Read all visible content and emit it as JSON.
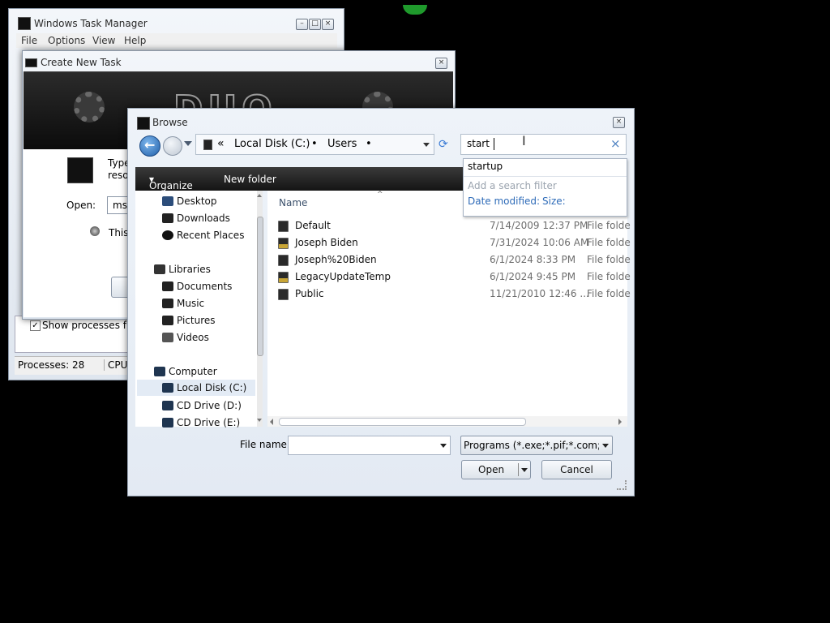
{
  "taskmgr": {
    "title": "Windows Task Manager",
    "menu": [
      "File",
      "Options",
      "View",
      "Help"
    ],
    "show_processes_label": "Show processes from",
    "status_processes": "Processes: 28",
    "status_cpu": "CPU U"
  },
  "create_task": {
    "title": "Create New Task",
    "type_text_1": "Type",
    "type_text_2": "reso",
    "open_label": "Open:",
    "open_value": "msc",
    "this_text": "This",
    "banner_text": "DUO"
  },
  "browse": {
    "title": "Browse",
    "breadcrumb": [
      "«",
      "Local Disk (C:)",
      "•",
      "Users",
      "•"
    ],
    "search_value": "start",
    "search_clear": "×",
    "toolbar": {
      "organize": "Organize",
      "new_folder": "New folder"
    },
    "suggestion": "startup",
    "add_filter": "Add a search filter",
    "filters": [
      "Date modified:",
      "Size:"
    ],
    "column_name": "Name",
    "nav": {
      "favorites": [
        "Desktop",
        "Downloads",
        "Recent Places"
      ],
      "libraries_header": "Libraries",
      "libraries": [
        "Documents",
        "Music",
        "Pictures",
        "Videos"
      ],
      "computer_header": "Computer",
      "drives": [
        "Local Disk (C:)",
        "CD Drive (D:)",
        "CD Drive (E:)"
      ]
    },
    "files": [
      {
        "name": "Default",
        "date": "7/14/2009 12:37 PM",
        "type": "File folde"
      },
      {
        "name": "Joseph Biden",
        "date": "7/31/2024 10:06 AM",
        "type": "File folde"
      },
      {
        "name": "Joseph%20Biden",
        "date": "6/1/2024 8:33 PM",
        "type": "File folde"
      },
      {
        "name": "LegacyUpdateTemp",
        "date": "6/1/2024 9:45 PM",
        "type": "File folde"
      },
      {
        "name": "Public",
        "date": "11/21/2010 12:46 ...",
        "type": "File folde"
      }
    ],
    "filename_label": "File name:",
    "filename_value": "",
    "filetype_value": "Programs (*.exe;*.pif;*.com;*.ba",
    "open_button": "Open",
    "cancel_button": "Cancel"
  }
}
